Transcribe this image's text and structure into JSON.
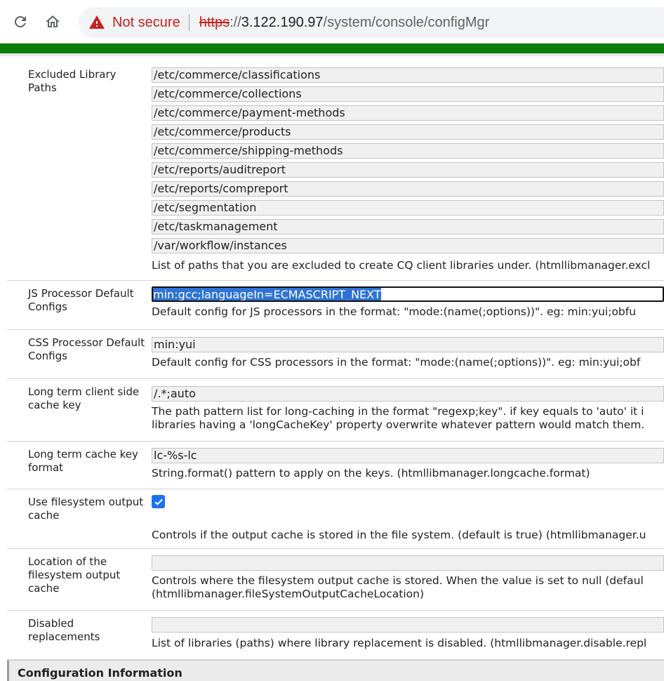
{
  "browser": {
    "security_label": "Not secure",
    "url_scheme": "https",
    "url_sep": "://",
    "url_host": "3.122.190.97",
    "url_path": "/system/console/configMgr",
    "warning_color": "#c5221f"
  },
  "config": {
    "excluded": {
      "label": "Excluded Library Paths",
      "values": [
        "/etc/commerce/classifications",
        "/etc/commerce/collections",
        "/etc/commerce/payment-methods",
        "/etc/commerce/products",
        "/etc/commerce/shipping-methods",
        "/etc/reports/auditreport",
        "/etc/reports/compreport",
        "/etc/segmentation",
        "/etc/taskmanagement",
        "/var/workflow/instances"
      ],
      "description": "List of paths that you are excluded to create CQ client libraries under. (htmllibmanager.excl"
    },
    "js": {
      "label": "JS Processor Default Configs",
      "value": "min:gcc;languageIn=ECMASCRIPT_NEXT",
      "description": "Default config for JS processors in the format: \"mode:(name(;options))\". eg: min:yui;obfu"
    },
    "css": {
      "label": "CSS Processor Default Configs",
      "value": "min:yui",
      "description": "Default config for CSS processors in the format: \"mode:(name(;options))\". eg: min:yui;obf"
    },
    "longterm_client": {
      "label": "Long term client side cache key",
      "value": "/.*;auto",
      "description_1": "The path pattern list for long-caching in the format \"regexp;key\". if key equals to 'auto' it i",
      "description_2": "libraries having a 'longCacheKey' property overwrite whatever pattern would match them."
    },
    "longterm_format": {
      "label": "Long term cache key format",
      "value": "lc-%s-lc",
      "description": "String.format() pattern to apply on the keys. (htmllibmanager.longcache.format)"
    },
    "fs_cache": {
      "label": "Use filesystem output cache",
      "checked": true,
      "description": "Controls if the output cache is stored in the file system. (default is true) (htmllibmanager.u"
    },
    "fs_location": {
      "label": "Location of the filesystem output cache",
      "value": "",
      "description_1": "Controls where the filesystem output cache is stored. When the value is set to null (defaul",
      "description_2": "(htmllibmanager.fileSystemOutputCacheLocation)"
    },
    "disabled_replacements": {
      "label": "Disabled replacements",
      "value": "",
      "description": "List of libraries (paths) where library replacement is disabled. (htmllibmanager.disable.repl"
    }
  },
  "footer": {
    "section_title": "Configuration Information"
  }
}
